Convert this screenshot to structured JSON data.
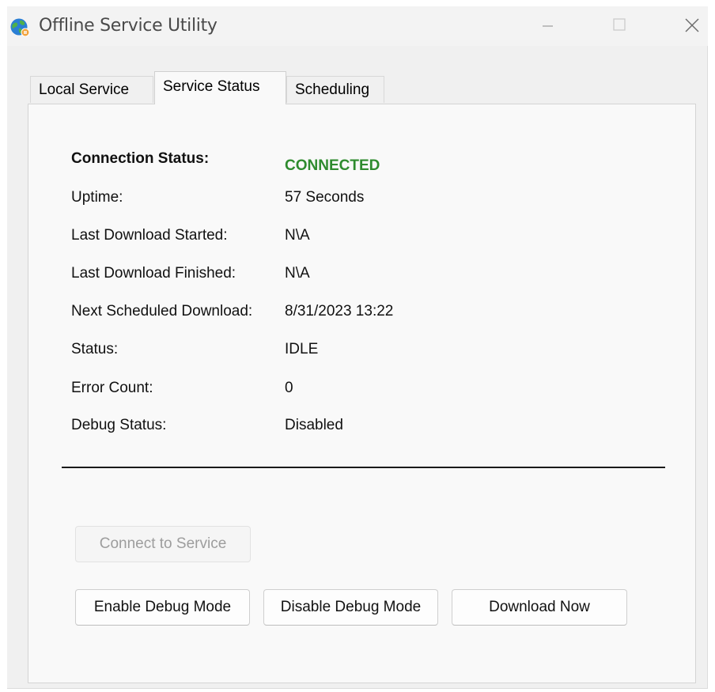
{
  "window": {
    "title": "Offline Service Utility",
    "icon": "globe-app-icon",
    "controls": [
      "minimize-icon",
      "maximize-icon",
      "close-icon"
    ]
  },
  "tabs": [
    {
      "label": "Local Service",
      "active": false
    },
    {
      "label": "Service Status",
      "active": true
    },
    {
      "label": "Scheduling",
      "active": false
    }
  ],
  "status": {
    "connection": {
      "label": "Connection Status:",
      "value": "CONNECTED",
      "color": "#2e8b2e"
    },
    "uptime": {
      "label": "Uptime:",
      "value": "57 Seconds"
    },
    "last_started": {
      "label": "Last Download Started:",
      "value": "N\\A"
    },
    "last_finished": {
      "label": "Last Download Finished:",
      "value": "N\\A"
    },
    "next_scheduled": {
      "label": "Next Scheduled Download:",
      "value": "8/31/2023 13:22"
    },
    "state": {
      "label": "Status:",
      "value": "IDLE"
    },
    "error_count": {
      "label": "Error Count:",
      "value": "0"
    },
    "debug": {
      "label": "Debug Status:",
      "value": "Disabled"
    }
  },
  "buttons": {
    "connect": {
      "label": "Connect to Service",
      "enabled": false
    },
    "enable_debug": {
      "label": "Enable Debug Mode",
      "enabled": true
    },
    "disable_debug": {
      "label": "Disable Debug Mode",
      "enabled": true
    },
    "download_now": {
      "label": "Download Now",
      "enabled": true
    }
  }
}
